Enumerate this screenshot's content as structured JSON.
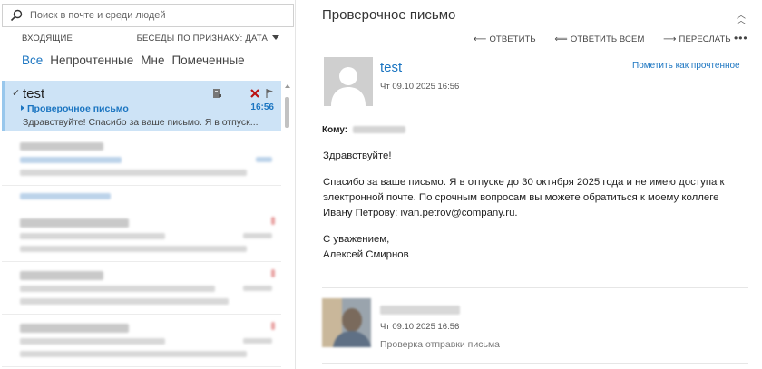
{
  "search": {
    "placeholder": "Поиск в почте и среди людей"
  },
  "folder": {
    "name": "ВХОДЯЩИЕ",
    "sort_label": "БЕСЕДЫ ПО ПРИЗНАКУ: ДАТА"
  },
  "filters": [
    {
      "label": "Все"
    },
    {
      "label": "Непрочтенные"
    },
    {
      "label": "Мне"
    },
    {
      "label": "Помеченные"
    }
  ],
  "messages": [
    {
      "sender": "test",
      "subject": "Проверочное письмо",
      "time": "16:56",
      "preview": "Здравствуйте! Спасибо за ваше письмо. Я в отпуск..."
    }
  ],
  "reading": {
    "title": "Проверочное письмо",
    "actions": {
      "reply": "ОТВЕТИТЬ",
      "reply_all": "ОТВЕТИТЬ ВСЕМ",
      "forward": "ПЕРЕСЛАТЬ"
    },
    "sender": "test",
    "date": "Чт 09.10.2025 16:56",
    "mark_unread": "Пометить как прочтенное",
    "to_label": "Кому:",
    "body": {
      "greeting": "Здравствуйте!",
      "line1": "Спасибо за ваше письмо. Я в отпуске до 30 октября 2025 года и не имею доступа к",
      "line2": "электронной почте. По срочным вопросам вы можете обратиться к моему коллеге",
      "line3": "Ивану Петрову: ivan.petrov@company.ru.",
      "signoff": "С уважением,",
      "signature": "Алексей Смирнов"
    },
    "reply_item": {
      "date": "Чт 09.10.2025 16:56",
      "preview": "Проверка отправки письма"
    }
  }
}
